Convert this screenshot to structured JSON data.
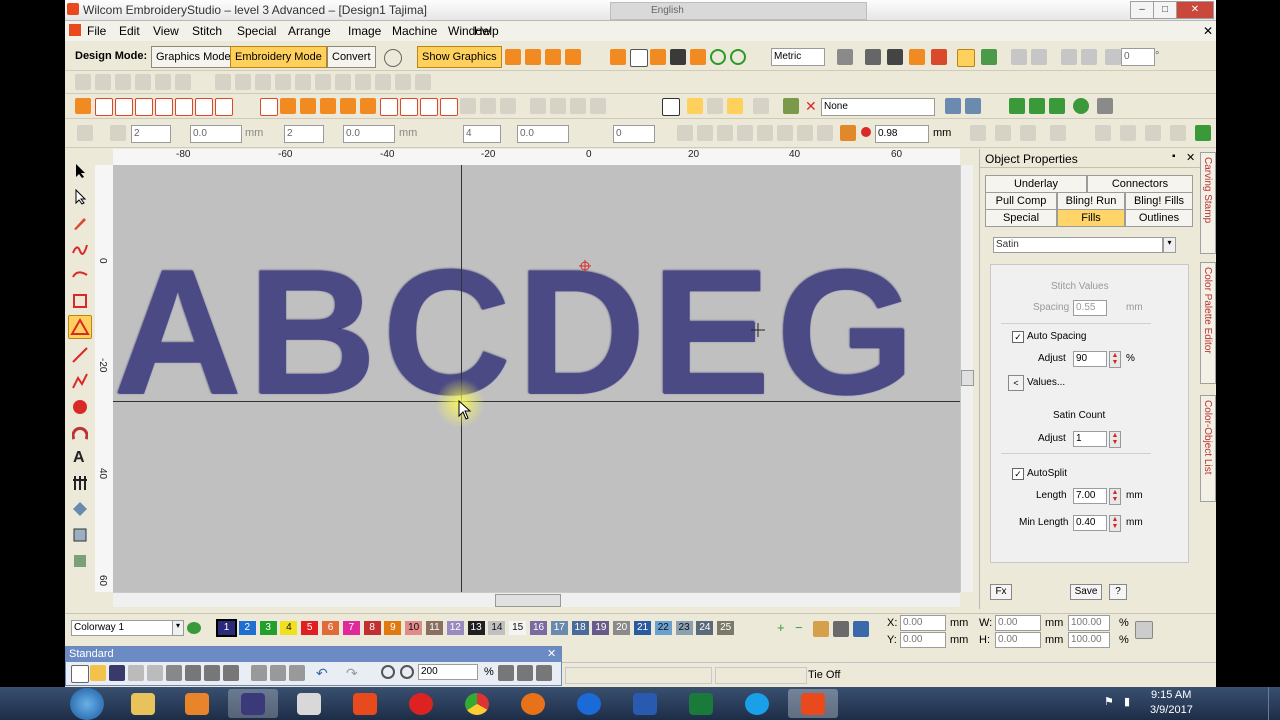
{
  "window": {
    "title": "Wilcom EmbroideryStudio – level 3 Advanced – [Design1      Tajima]",
    "min": "–",
    "max": "□",
    "close": "✕",
    "lang": "English"
  },
  "menu": [
    "File",
    "Edit",
    "View",
    "Stitch",
    "Special",
    "Arrange",
    "Image",
    "Machine",
    "Window",
    "Help"
  ],
  "toolbar1": {
    "design_mode_label": "Design Mode:",
    "graphics_mode": "Graphics Mode",
    "embroidery_mode": "Embroidery Mode",
    "convert": "Convert",
    "show_graphics": "Show Graphics",
    "units": "Metric",
    "zoom_input": "0",
    "zoom_unit": "°"
  },
  "toolbar3": {
    "none_label": "None"
  },
  "toolbar4": {
    "f1": "2",
    "f2": "0.0",
    "f3": "2",
    "f4": "0.0",
    "unit_mm": "mm",
    "f5": "4",
    "f6": "0.0",
    "f7": "0",
    "f8": "0.98",
    "unit_mm2": "mm"
  },
  "ruler": {
    "h": [
      "-80",
      "-60",
      "-40",
      "-20",
      "0",
      "20",
      "40",
      "60"
    ],
    "v": [
      "0",
      "-20",
      "40",
      "60"
    ]
  },
  "canvas": {
    "text": "ABCDEG"
  },
  "panel": {
    "title": "Object Properties",
    "tabs": [
      "Underlay",
      "Connectors",
      "Pull Comp",
      "Bling! Run",
      "Bling! Fills",
      "Special",
      "Fills",
      "Outlines"
    ],
    "fill_type": "Satin",
    "stitch_values": "Stitch Values",
    "spacing_label": "Spacing",
    "spacing_value": "0.55",
    "spacing_unit": "mm",
    "auto_spacing": "Auto Spacing",
    "adjust_label": "Adjust",
    "adjust_value": "90",
    "adjust_unit": "%",
    "values_btn": "Values...",
    "values_arrow": "<",
    "satin_count": "Satin Count",
    "adjust2_label": "Adjust",
    "adjust2_value": "1",
    "autosplit": "AutoSplit",
    "length_label": "Length",
    "length_value": "7.00",
    "length_unit": "mm",
    "minlength_label": "Min Length",
    "minlength_value": "0.40",
    "minlength_unit": "mm",
    "fx_btn": "Fx",
    "save_btn": "Save",
    "help_btn": "?"
  },
  "side_tabs": [
    "Carving Stamp",
    "Color Palette Editor",
    "Color-Object List"
  ],
  "colorbar": {
    "colorway": "Colorway 1",
    "swatches": [
      {
        "n": "1",
        "c": "#2a2a7a"
      },
      {
        "n": "2",
        "c": "#1e6fd0"
      },
      {
        "n": "3",
        "c": "#22a02a"
      },
      {
        "n": "4",
        "c": "#f0e020"
      },
      {
        "n": "5",
        "c": "#e02020"
      },
      {
        "n": "6",
        "c": "#e06a3a"
      },
      {
        "n": "7",
        "c": "#e02a9a"
      },
      {
        "n": "8",
        "c": "#c03030"
      },
      {
        "n": "9",
        "c": "#e07a10"
      },
      {
        "n": "10",
        "c": "#e08a8a"
      },
      {
        "n": "11",
        "c": "#8a7060"
      },
      {
        "n": "12",
        "c": "#9a8ac0"
      },
      {
        "n": "13",
        "c": "#202020"
      },
      {
        "n": "14",
        "c": "#c0c0c0"
      },
      {
        "n": "15",
        "c": "#f4f4f4"
      },
      {
        "n": "16",
        "c": "#7a6aa0"
      },
      {
        "n": "17",
        "c": "#6a8ab0"
      },
      {
        "n": "18",
        "c": "#4a6a9a"
      },
      {
        "n": "19",
        "c": "#6a5a8a"
      },
      {
        "n": "20",
        "c": "#8a8a8a"
      },
      {
        "n": "21",
        "c": "#2a5aa0"
      },
      {
        "n": "22",
        "c": "#6aa0d0"
      },
      {
        "n": "23",
        "c": "#8aa0b0"
      },
      {
        "n": "24",
        "c": "#5a6a7a"
      },
      {
        "n": "25",
        "c": "#7a7a6a"
      }
    ],
    "x_label": "X:",
    "x_val": "0.00",
    "y_label": "Y:",
    "y_val": "0.00",
    "w_label": "W:",
    "w_val": "0.00",
    "h_label": "H:",
    "h_val": "0.00",
    "unit": "mm",
    "pct1": "100.00",
    "pct2": "100.00",
    "pct_sign": "%"
  },
  "standard_tb": {
    "title": "Standard",
    "zoom": "200",
    "pct": "%"
  },
  "status": {
    "text": "Tie Off"
  },
  "taskbar": {
    "time": "9:15 AM",
    "date": "3/9/2017"
  }
}
